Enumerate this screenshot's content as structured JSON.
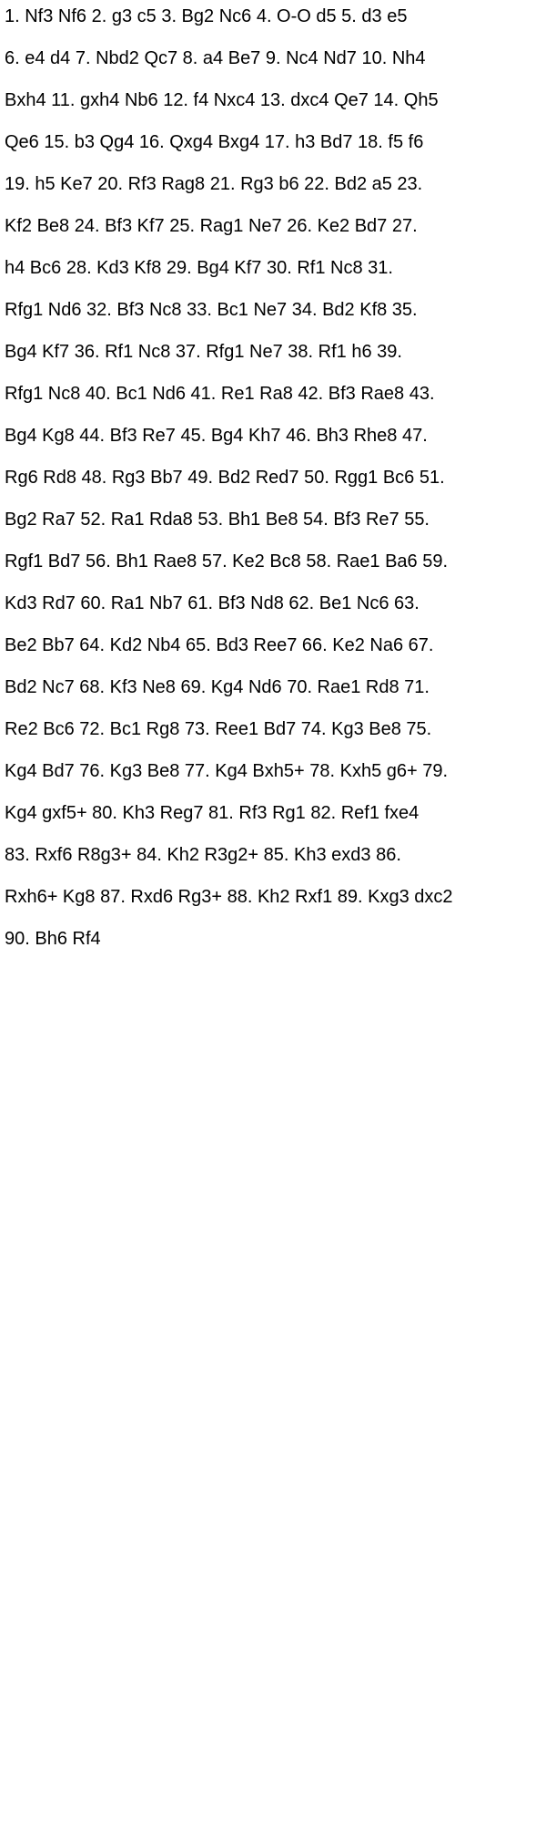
{
  "document": {
    "lines": [
      "1. Nf3 Nf6 2. g3 c5 3. Bg2 Nc6 4. O-O d5 5. d3 e5",
      "6. e4 d4 7. Nbd2 Qc7 8. a4 Be7 9. Nc4 Nd7 10. Nh4",
      "Bxh4 11. gxh4 Nb6 12. f4 Nxc4 13. dxc4 Qe7 14. Qh5",
      "Qe6 15. b3 Qg4 16. Qxg4 Bxg4 17. h3 Bd7 18. f5 f6",
      "19. h5 Ke7 20. Rf3 Rag8 21. Rg3 b6 22. Bd2 a5 23.",
      "Kf2 Be8 24. Bf3 Kf7 25. Rag1 Ne7 26. Ke2 Bd7 27.",
      "h4 Bc6 28. Kd3 Kf8 29. Bg4 Kf7 30. Rf1 Nc8 31.",
      "Rfg1 Nd6 32. Bf3 Nc8 33. Bc1 Ne7 34. Bd2 Kf8 35.",
      "Bg4 Kf7 36. Rf1 Nc8 37. Rfg1 Ne7 38. Rf1 h6 39.",
      "Rfg1 Nc8 40. Bc1 Nd6 41. Re1 Ra8 42. Bf3 Rae8 43.",
      "Bg4 Kg8 44. Bf3 Re7 45. Bg4 Kh7 46. Bh3 Rhe8 47.",
      "Rg6 Rd8 48. Rg3 Bb7 49. Bd2 Red7 50. Rgg1 Bc6 51.",
      "Bg2 Ra7 52. Ra1 Rda8 53. Bh1 Be8 54. Bf3 Re7 55.",
      "Rgf1 Bd7 56. Bh1 Rae8 57. Ke2 Bc8 58. Rae1 Ba6 59.",
      "Kd3 Rd7 60. Ra1 Nb7 61. Bf3 Nd8 62. Be1 Nc6 63.",
      "Be2 Bb7 64. Kd2 Nb4 65. Bd3 Ree7 66. Ke2 Na6 67.",
      "Bd2 Nc7 68. Kf3 Ne8 69. Kg4 Nd6 70. Rae1 Rd8 71.",
      "Re2 Bc6 72. Bc1 Rg8 73. Ree1 Bd7 74. Kg3 Be8 75.",
      "Kg4 Bd7 76. Kg3 Be8 77. Kg4 Bxh5+ 78. Kxh5 g6+ 79.",
      "Kg4 gxf5+ 80. Kh3 Reg7 81. Rf3 Rg1 82. Ref1 fxe4",
      "83. Rxf6 R8g3+ 84. Kh2 R3g2+ 85. Kh3 exd3 86.",
      "Rxh6+ Kg8 87. Rxd6 Rg3+ 88. Kh2 Rxf1 89. Kxg3 dxc2",
      "90. Bh6 Rf4"
    ]
  }
}
